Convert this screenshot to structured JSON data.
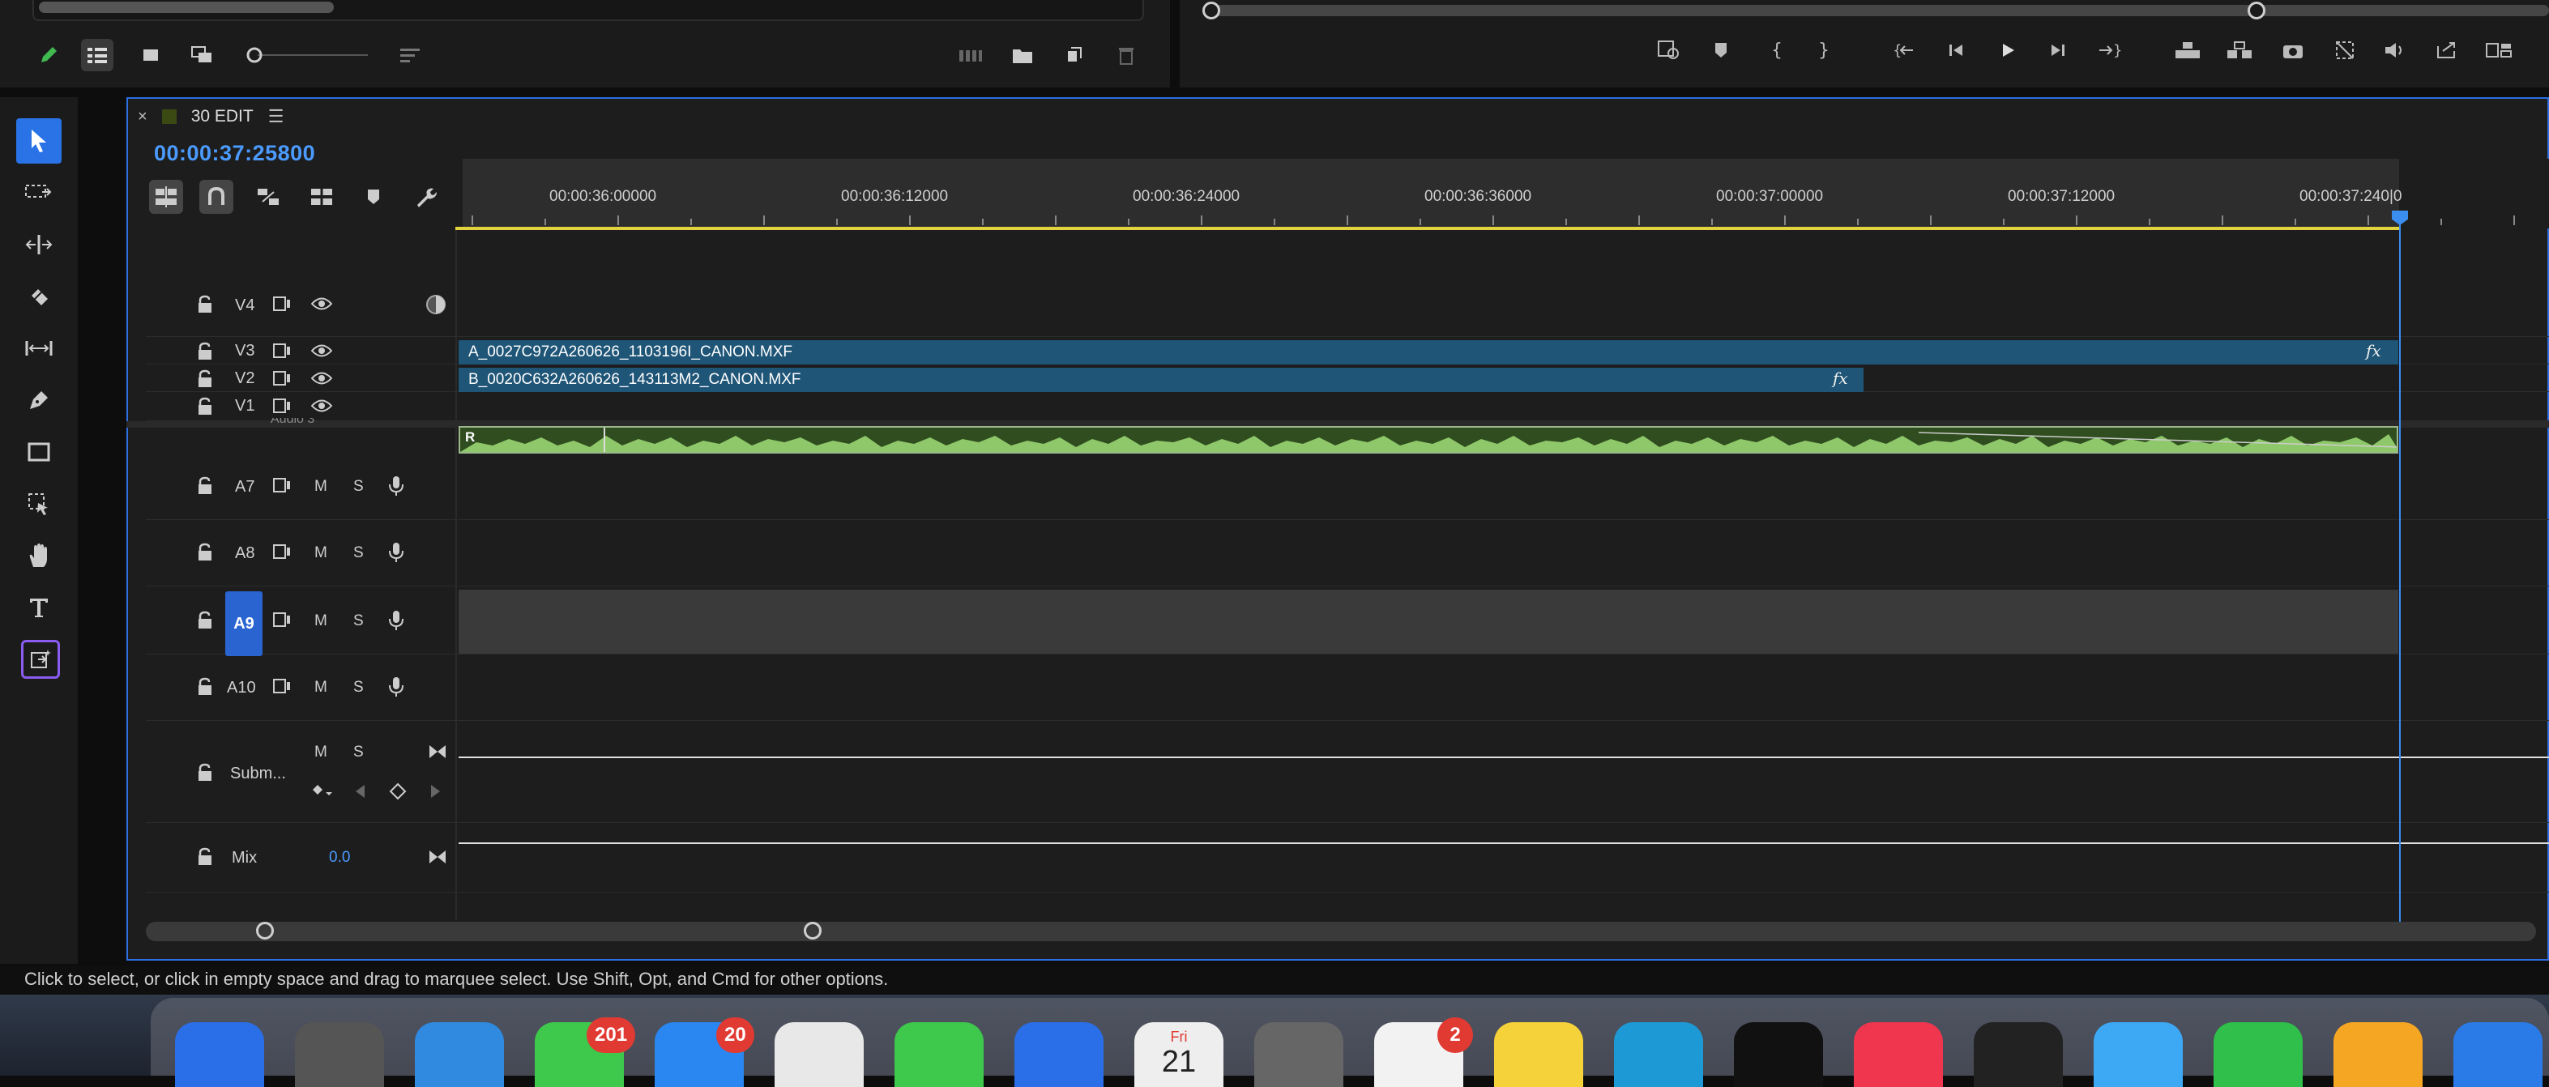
{
  "sequence": {
    "name": "30 EDIT",
    "timecode": "00:00:37:25800",
    "swatch_color": "#3b4a12"
  },
  "ruler": {
    "labels": [
      "00:00:36:00000",
      "00:00:36:12000",
      "00:00:36:24000",
      "00:00:36:36000",
      "00:00:37:00000",
      "00:00:37:12000",
      "00:00:37:240|0"
    ]
  },
  "video_tracks": [
    {
      "name": "V4"
    },
    {
      "name": "V3"
    },
    {
      "name": "V2"
    },
    {
      "name": "V1"
    }
  ],
  "clips": [
    {
      "name": "A_0027C972A260626_1103196I_CANON.MXF",
      "track": "V3",
      "fx": "fx"
    },
    {
      "name": "B_0020C632A260626_143113M2_CANON.MXF",
      "track": "V2",
      "fx": "fx"
    }
  ],
  "audio_clip": {
    "channel_label": "R",
    "partial_label": "Audio 3"
  },
  "audio_tracks": [
    {
      "name": "A7",
      "m": "M",
      "s": "S"
    },
    {
      "name": "A8",
      "m": "M",
      "s": "S"
    },
    {
      "name": "A9",
      "m": "M",
      "s": "S"
    },
    {
      "name": "A10",
      "m": "M",
      "s": "S"
    }
  ],
  "submix": {
    "name": "Subm...",
    "m": "M",
    "s": "S"
  },
  "mix": {
    "name": "Mix",
    "value": "0.0"
  },
  "status_bar": "Click to select, or click in empty space and drag to marquee select. Use Shift, Opt, and Cmd for other options.",
  "dock": {
    "messages_badge": "201",
    "mail_badge": "20",
    "calendar_day": "Fri",
    "calendar_date": "21",
    "reminders_badge": "2"
  },
  "colors": {
    "accent": "#2b6fe0",
    "timecode": "#4b9bff",
    "clip": "#1f5577",
    "audio_wave": "#8fc86a",
    "work_area": "#e3d23f"
  }
}
